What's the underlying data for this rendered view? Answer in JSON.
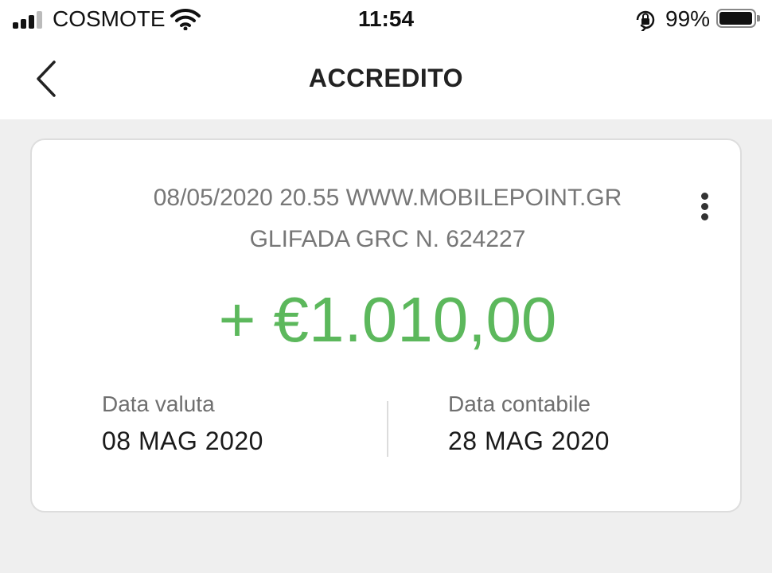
{
  "status_bar": {
    "carrier": "COSMOTE",
    "time": "11:54",
    "battery_percent": "99%",
    "icons": [
      "signal-icon",
      "wifi-icon",
      "orientation-lock-icon",
      "battery-icon"
    ]
  },
  "header": {
    "title": "ACCREDITO",
    "back_icon": "chevron-left-icon"
  },
  "transaction": {
    "description_line1": "08/05/2020 20.55 WWW.MOBILEPOINT.GR",
    "description_line2": "GLIFADA GRC N. 624227",
    "amount": "+ €1.010,00",
    "menu_icon": "more-vertical-icon",
    "value_date_label": "Data valuta",
    "value_date": "08 MAG 2020",
    "accounting_date_label": "Data contabile",
    "accounting_date": "28 MAG 2020"
  },
  "colors": {
    "amount_positive": "#5cb85c",
    "background": "#efefef",
    "card": "#ffffff"
  }
}
